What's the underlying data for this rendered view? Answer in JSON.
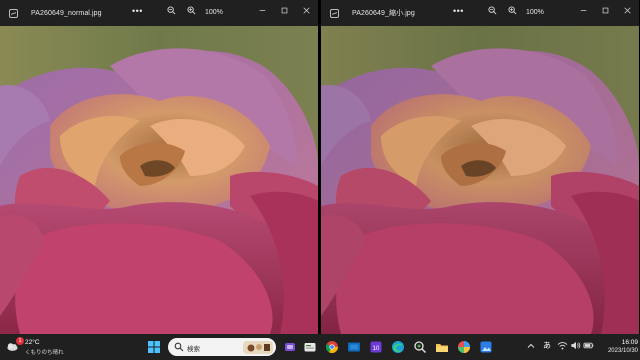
{
  "windows": [
    {
      "file_name": "PA260649_normal.jpg",
      "more_label": "•••",
      "zoom": "100%",
      "zoom_out_icon": "zoom-out-icon",
      "zoom_in_icon": "zoom-in-icon"
    },
    {
      "file_name": "PA260649_縮小.jpg",
      "more_label": "•••",
      "zoom": "100%",
      "zoom_out_icon": "zoom-out-icon",
      "zoom_in_icon": "zoom-in-icon"
    }
  ],
  "taskbar": {
    "weather": {
      "temp": "22°C",
      "desc": "くもりのち晴れ",
      "badge": "1"
    },
    "search_placeholder": "検索",
    "pinned": [
      "start-icon",
      "search",
      "task-view-icon",
      "files-icon",
      "chrome-icon",
      "mail-icon",
      "calendar-icon",
      "edge-icon",
      "app-icon",
      "explorer-icon",
      "color-app-icon",
      "image-viewer-icon"
    ],
    "calendar_day": "10",
    "tray": {
      "ime": "あ"
    },
    "clock": {
      "time": "16:09",
      "date": "2023/10/30"
    }
  },
  "colors": {
    "titlebar": "#202020",
    "taskbar": "#202020",
    "search_box": "#f3f3f3"
  }
}
